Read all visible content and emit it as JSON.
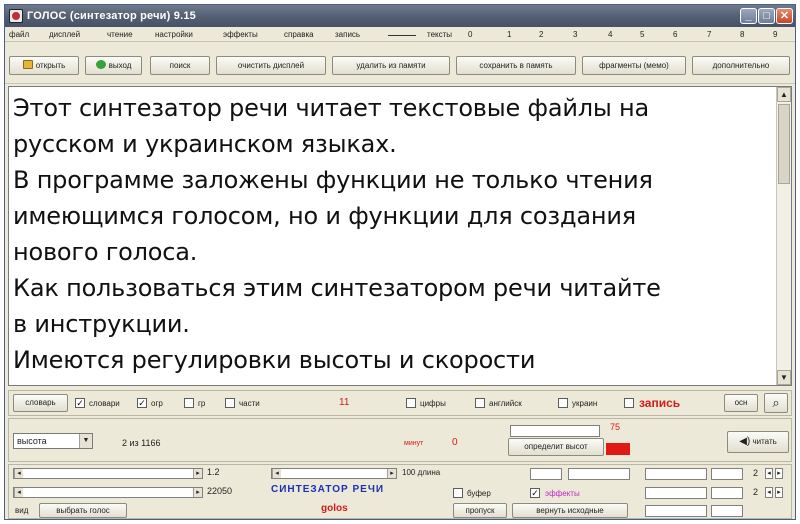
{
  "window": {
    "title": "ГОЛОС (синтезатор речи) 9.15"
  },
  "menu": {
    "items": [
      "файл",
      "дисплей",
      "чтение",
      "настройки",
      "эффекты",
      "справка",
      "запись"
    ],
    "texts_label": "тексты",
    "text_slots": [
      "0",
      "1",
      "2",
      "3",
      "4",
      "5",
      "6",
      "7",
      "8",
      "9"
    ]
  },
  "toolbar": {
    "open": "открыть",
    "exit": "выход",
    "search": "поиск",
    "clear_display": "очистить дисплей",
    "delete_from_memory": "удалить из памяти",
    "save_to_memory": "сохранить в память",
    "fragments": "фрагменты (мемо)",
    "additional": "дополнительно"
  },
  "editor": {
    "lines": [
      "Этот синтезатор речи читает текстовые файлы на",
      "русском и украинском языках.",
      "В программе заложены функции не только чтения",
      "имеющимся голосом, но и функции для создания",
      "нового голоса.",
      "Как пользоваться этим синтезатором речи читайте",
      "в инструкции.",
      "Имеются регулировки высоты и скорости"
    ]
  },
  "controls": {
    "dictionary_button": "словарь",
    "chk_dictionaries": "словари",
    "chk_ogr": "огр",
    "chk_gr": "гр",
    "chk_parts": "части",
    "count_value": "11",
    "chk_digits": "цифры",
    "chk_english": "английск",
    "chk_ukrainian": "украин",
    "record_label": "запись",
    "osn_button": "осн",
    "zoom_icon": "magnifier-icon",
    "pitch_select": "высота",
    "position_text": "2 из 1166",
    "minutes_label": "минут",
    "minutes_value": "0",
    "level_value": "75",
    "define_pitch_button": "определит высот",
    "read_button": "читать",
    "read_icon": "speaker-icon",
    "slider1_value": "1.2",
    "slider2_value": "22050",
    "slider3_value": "100 длина",
    "synth_label": "СИНТЕЗАТОР РЕЧИ",
    "golos_label": "golos",
    "buffer_label": "буфер",
    "effects_label": "эффекты",
    "skip_button": "пропуск",
    "restore_button": "вернуть исходные",
    "voice_label": "вид",
    "choose_voice_button": "выбрать голос",
    "spin1_value": "2",
    "spin2_value": "2",
    "accent_red": "#e01a12",
    "accent_blue": "#1d2fb6"
  }
}
